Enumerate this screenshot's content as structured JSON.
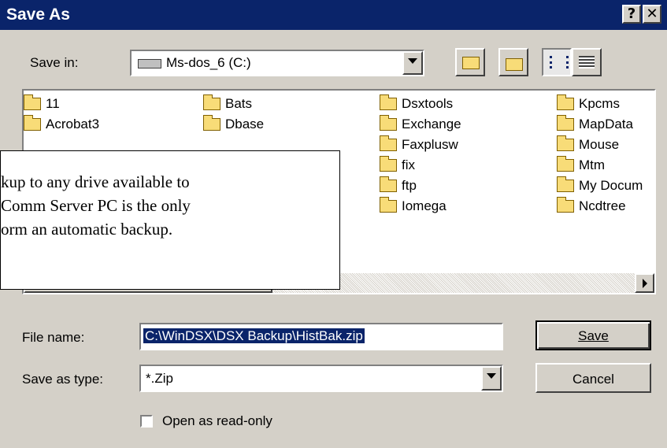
{
  "window": {
    "title": "Save As",
    "help_button": "?",
    "close_button": "✕"
  },
  "save_in": {
    "label": "Save in:",
    "value": "Ms-dos_6 (C:)"
  },
  "folders": {
    "col1": [
      "11",
      "Acrobat3"
    ],
    "col2": [
      "Bats",
      "Dbase"
    ],
    "col3": [
      "Dsxtools",
      "Exchange",
      "Faxplusw",
      "fix",
      "ftp",
      "Iomega"
    ],
    "col4": [
      "Kpcms",
      "MapData",
      "Mouse",
      "Mtm",
      "My Docum",
      "Ncdtree"
    ]
  },
  "callout": {
    "lines": [
      "kup to any drive available to",
      " Comm Server PC is the only",
      "orm an automatic backup."
    ]
  },
  "file_name": {
    "label": "File name:",
    "value": "C:\\WinDSX\\DSX Backup\\HistBak.zip"
  },
  "save_as_type": {
    "label": "Save as type:",
    "value": "*.Zip"
  },
  "buttons": {
    "save": "Save",
    "cancel": "Cancel"
  },
  "read_only": {
    "label": "Open as read-only"
  }
}
